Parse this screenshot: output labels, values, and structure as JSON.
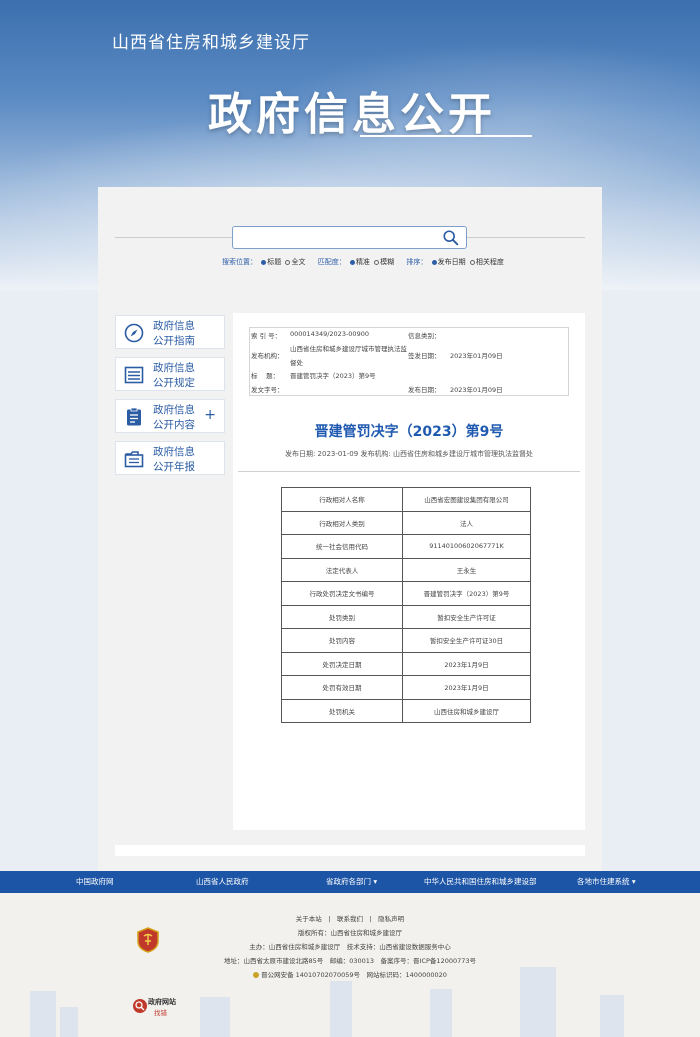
{
  "header": {
    "site_name": "山西省住房和城乡建设厅",
    "title": "政府信息公开"
  },
  "search": {
    "placeholder": "",
    "position_label": "搜索位置：",
    "position_options": [
      "标题",
      "全文"
    ],
    "match_label": "匹配度：",
    "match_options": [
      "精准",
      "模糊"
    ],
    "sort_label": "排序：",
    "sort_options": [
      "发布日期",
      "相关程度"
    ]
  },
  "sidebar": {
    "items": [
      {
        "label_line1": "政府信息",
        "label_line2": "公开指南",
        "icon": "compass-icon"
      },
      {
        "label_line1": "政府信息",
        "label_line2": "公开规定",
        "icon": "list-icon"
      },
      {
        "label_line1": "政府信息",
        "label_line2": "公开内容",
        "icon": "clipboard-icon",
        "expand": "+"
      },
      {
        "label_line1": "政府信息",
        "label_line2": "公开年报",
        "icon": "folder-icon"
      }
    ]
  },
  "meta": {
    "index_label": "索 引 号：",
    "index_value": "000014349/2023-00900",
    "category_label": "信息类别：",
    "category_value": "",
    "publisher_label": "发布机构：",
    "publisher_value_1": "山西省住房和城乡建设厅城市管理执法监",
    "publisher_value_2": "督处",
    "signed_label": "签发日期：",
    "signed_value": "2023年01月09日",
    "title_label": "标　 题：",
    "title_value": "晋建管罚决字（2023）第9号",
    "docno_label": "发文字号：",
    "docno_value": "",
    "publish_label": "发布日期：",
    "publish_value": "2023年01月09日"
  },
  "document": {
    "title": "晋建管罚决字（2023）第9号",
    "subtitle": "发布日期: 2023-01-09 发布机构: 山西省住房和城乡建设厅城市管理执法监督处"
  },
  "penalty_table": [
    {
      "key": "行政相对人名称",
      "value": "山西省宏图建设集团有限公司"
    },
    {
      "key": "行政相对人类别",
      "value": "法人"
    },
    {
      "key": "统一社会信用代码",
      "value": "91140100602067771K"
    },
    {
      "key": "法定代表人",
      "value": "王永生"
    },
    {
      "key": "行政处罚决定文书编号",
      "value": "晋建管罚决字（2023）第9号"
    },
    {
      "key": "处罚类别",
      "value": "暂扣安全生产许可证"
    },
    {
      "key": "处罚内容",
      "value": "暂扣安全生产许可证30日"
    },
    {
      "key": "处罚决定日期",
      "value": "2023年1月9日"
    },
    {
      "key": "处罚有效日期",
      "value": "2023年1月9日"
    },
    {
      "key": "处罚机关",
      "value": "山西住房和城乡建设厅"
    }
  ],
  "navbar": {
    "items": [
      "中国政府网",
      "山西省人民政府",
      "省政府各部门",
      "中华人民共和国住房和城乡建设部",
      "各地市住建系统"
    ],
    "dropdown_mark": "▾"
  },
  "footer": {
    "links": "关于本站　|　联系我们　|　隐私声明",
    "copyright": "版权所有：山西省住房和城乡建设厅",
    "host": "主办：山西省住房和城乡建设厅　技术支持：山西省建设数据服务中心",
    "address": "地址：山西省太原市建设北路85号　邮编：030013　备案序号：晋ICP备12000773号",
    "police": "晋公网安备 14010702070059号　网站标识码：1400000020",
    "badge_line1": "政府网站",
    "badge_line2": "找错"
  },
  "colors": {
    "brand_blue": "#1d55a6",
    "link_blue": "#2a5ba3",
    "title_blue": "#1f5ab0"
  }
}
